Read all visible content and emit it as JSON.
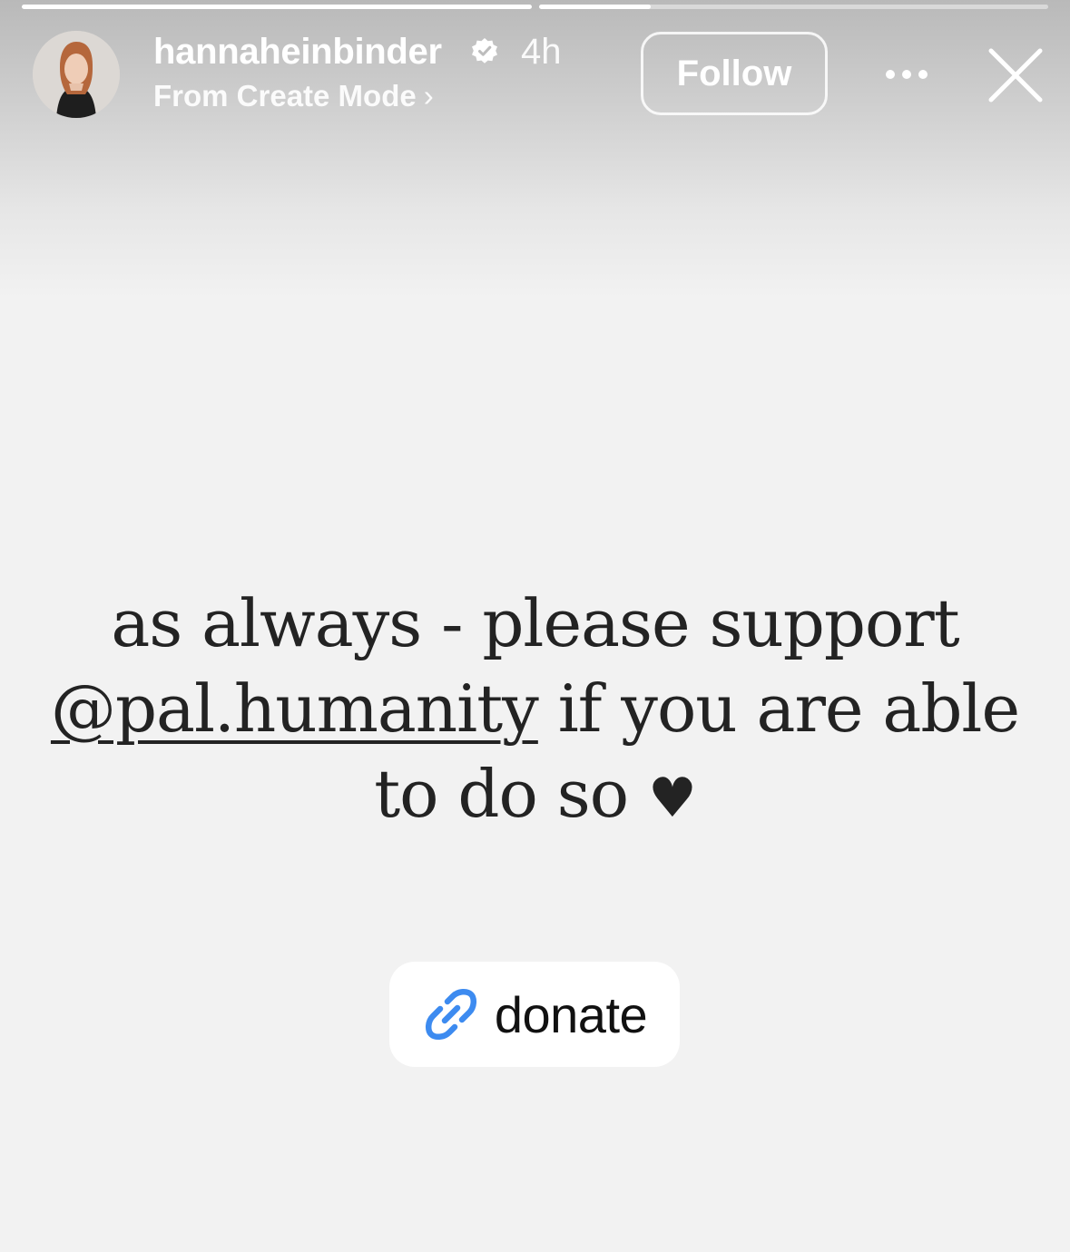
{
  "story": {
    "progress": [
      1.0,
      0.22
    ],
    "author": {
      "username": "hannaheinbinder",
      "verified": true,
      "time_ago": "4h",
      "source_label": "From Create Mode",
      "source_chevron": "›"
    },
    "actions": {
      "follow_label": "Follow",
      "more_icon": "more-horizontal-icon",
      "close_icon": "close-icon"
    },
    "text": {
      "line1": "as always - please support",
      "mention": "@pal.humanity",
      "line2_rest": " if you are able",
      "line3": "to do so",
      "heart": "♥"
    },
    "sticker": {
      "icon": "link-icon",
      "label": "donate",
      "icon_color": "#3d8bf0"
    }
  }
}
